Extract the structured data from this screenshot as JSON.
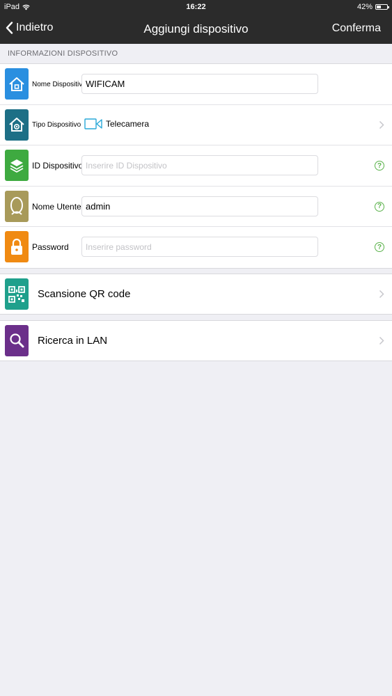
{
  "status_bar": {
    "device": "iPad",
    "time": "16:22",
    "battery": "42%",
    "battery_level": 0.42
  },
  "nav": {
    "back_label": "Indietro",
    "title": "Aggiungi dispositivo",
    "confirm_label": "Conferma"
  },
  "section": {
    "header": "INFORMAZIONI DISPOSITIVO"
  },
  "device_info": {
    "name": {
      "label": "Nome Dispositivo",
      "value": "WIFICAM",
      "icon": "home-icon",
      "color": "#2a8fe0"
    },
    "type": {
      "label": "Tipo Dispositivo",
      "value": "Telecamera",
      "icon": "home-camera-icon",
      "color": "#1d6f86"
    },
    "id": {
      "label": "ID Dispositivo",
      "placeholder": "Inserire ID Dispositivo",
      "icon": "layers-icon",
      "color": "#3eaa40"
    },
    "user": {
      "label": "Nome Utente",
      "value": "admin",
      "icon": "person-icon",
      "color": "#a89a5a"
    },
    "password": {
      "label": "Password",
      "placeholder": "Inserire password",
      "icon": "lock-icon",
      "color": "#f08a12"
    }
  },
  "actions": {
    "qr": {
      "label": "Scansione QR code",
      "icon": "qr-code-icon",
      "color": "#1fa08c"
    },
    "lan": {
      "label": "Ricerca in LAN",
      "icon": "search-icon",
      "color": "#6b2f8a"
    }
  },
  "help_symbol": "?"
}
